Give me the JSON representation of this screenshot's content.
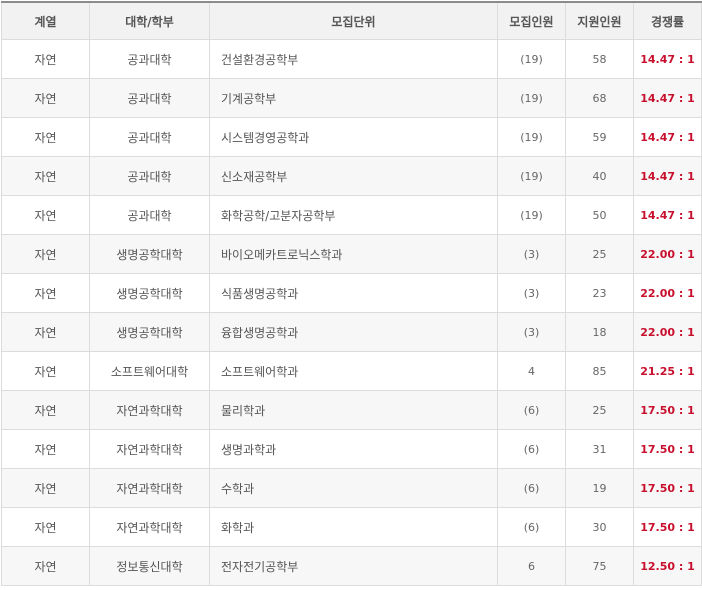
{
  "table": {
    "headers": [
      "계열",
      "대학/학부",
      "모집단위",
      "모집인원",
      "지원인원",
      "경쟁률"
    ],
    "rows": [
      [
        "자연",
        "공과대학",
        "건설환경공학부",
        "(19)",
        "58",
        "14.47 : 1"
      ],
      [
        "자연",
        "공과대학",
        "기계공학부",
        "(19)",
        "68",
        "14.47 : 1"
      ],
      [
        "자연",
        "공과대학",
        "시스템경영공학과",
        "(19)",
        "59",
        "14.47 : 1"
      ],
      [
        "자연",
        "공과대학",
        "신소재공학부",
        "(19)",
        "40",
        "14.47 : 1"
      ],
      [
        "자연",
        "공과대학",
        "화학공학/고분자공학부",
        "(19)",
        "50",
        "14.47 : 1"
      ],
      [
        "자연",
        "생명공학대학",
        "바이오메카트로닉스학과",
        "(3)",
        "25",
        "22.00 : 1"
      ],
      [
        "자연",
        "생명공학대학",
        "식품생명공학과",
        "(3)",
        "23",
        "22.00 : 1"
      ],
      [
        "자연",
        "생명공학대학",
        "융합생명공학과",
        "(3)",
        "18",
        "22.00 : 1"
      ],
      [
        "자연",
        "소프트웨어대학",
        "소프트웨어학과",
        "4",
        "85",
        "21.25 : 1"
      ],
      [
        "자연",
        "자연과학대학",
        "물리학과",
        "(6)",
        "25",
        "17.50 : 1"
      ],
      [
        "자연",
        "자연과학대학",
        "생명과학과",
        "(6)",
        "31",
        "17.50 : 1"
      ],
      [
        "자연",
        "자연과학대학",
        "수학과",
        "(6)",
        "19",
        "17.50 : 1"
      ],
      [
        "자연",
        "자연과학대학",
        "화학과",
        "(6)",
        "30",
        "17.50 : 1"
      ],
      [
        "자연",
        "정보통신대학",
        "전자전기공학부",
        "6",
        "75",
        "12.50 : 1"
      ]
    ]
  },
  "colors": {
    "ratio_text": "#c8102e",
    "header_bg": "#f2f2f2",
    "border": "#dcdcdc"
  }
}
